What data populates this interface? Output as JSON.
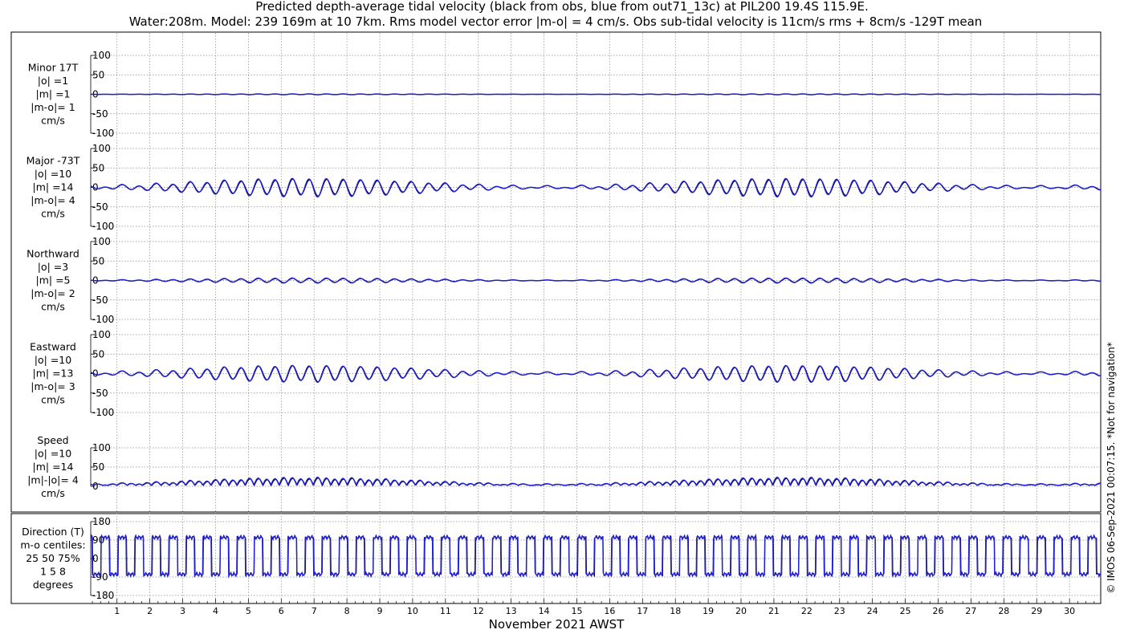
{
  "title": {
    "line1": "Predicted depth-average tidal velocity (black from obs, blue from out71_13c) at PIL200 19.4S 115.9E.",
    "line2": "Water:208m. Model: 239 169m at 10 7km. Rms model vector error |m-o| = 4 cm/s. Obs sub-tidal velocity is 11cm/s rms + 8cm/s -129T mean"
  },
  "copyright": "© IMOS 06-Sep-2021 00:07:15. *Not for navigation*",
  "colors": {
    "obs": "#000000",
    "model": "#1f1fd0",
    "grid": "#8c8c8c",
    "frame": "#000000"
  },
  "chart_data": {
    "type": "line",
    "xlabel": "November 2021 AWST",
    "x_ticks": [
      "1",
      "2",
      "3",
      "4",
      "5",
      "6",
      "7",
      "8",
      "9",
      "10",
      "11",
      "12",
      "13",
      "14",
      "15",
      "16",
      "17",
      "18",
      "19",
      "20",
      "21",
      "22",
      "23",
      "24",
      "25",
      "26",
      "27",
      "28",
      "29",
      "30"
    ],
    "xlim": [
      0.2,
      30.95
    ],
    "series_legend": [
      "black from obs",
      "blue from out71_13c"
    ],
    "panels": [
      {
        "id": "minor",
        "label_lines": [
          "Minor 17T",
          "|o| =1",
          "|m| =1",
          "|m-o|= 1",
          "cm/s"
        ],
        "ylim": [
          -100,
          100
        ],
        "yticks": [
          "100",
          "50",
          "0",
          "-50",
          "-100"
        ],
        "amp_obs": 1,
        "amp_model": 1,
        "kind": "tide"
      },
      {
        "id": "major",
        "label_lines": [
          "Major -73T",
          "|o| =10",
          "|m| =14",
          "|m-o|= 4",
          "cm/s"
        ],
        "ylim": [
          -100,
          100
        ],
        "yticks": [
          "100",
          "50",
          "0",
          "-50",
          "-100"
        ],
        "amp_obs": 20,
        "amp_model": 22,
        "kind": "tide"
      },
      {
        "id": "northward",
        "label_lines": [
          "Northward",
          "|o| =3",
          "|m| =5",
          "|m-o|= 2",
          "cm/s"
        ],
        "ylim": [
          -100,
          100
        ],
        "yticks": [
          "100",
          "50",
          "0",
          "-50",
          "-100"
        ],
        "amp_obs": 5,
        "amp_model": 6,
        "kind": "tide"
      },
      {
        "id": "eastward",
        "label_lines": [
          "Eastward",
          "|o| =10",
          "|m| =13",
          "|m-o|= 3",
          "cm/s"
        ],
        "ylim": [
          -100,
          100
        ],
        "yticks": [
          "100",
          "50",
          "0",
          "-50",
          "-100"
        ],
        "amp_obs": 19,
        "amp_model": 20,
        "kind": "tide"
      },
      {
        "id": "speed",
        "label_lines": [
          "Speed",
          "|o| =10",
          "|m| =14",
          "|m|-|o|= 4",
          "cm/s"
        ],
        "ylim": [
          0,
          100
        ],
        "yticks": [
          "100",
          "50",
          "0"
        ],
        "amp_obs": 20,
        "amp_model": 22,
        "kind": "speed"
      },
      {
        "id": "direction",
        "label_lines": [
          "Direction (T)",
          "m-o centiles:",
          "25  50  75%",
          "1   5   8",
          "degrees"
        ],
        "ylim": [
          -180,
          180
        ],
        "yticks": [
          "180",
          "90",
          "0",
          "-90",
          "-180"
        ],
        "kind": "direction"
      }
    ]
  }
}
